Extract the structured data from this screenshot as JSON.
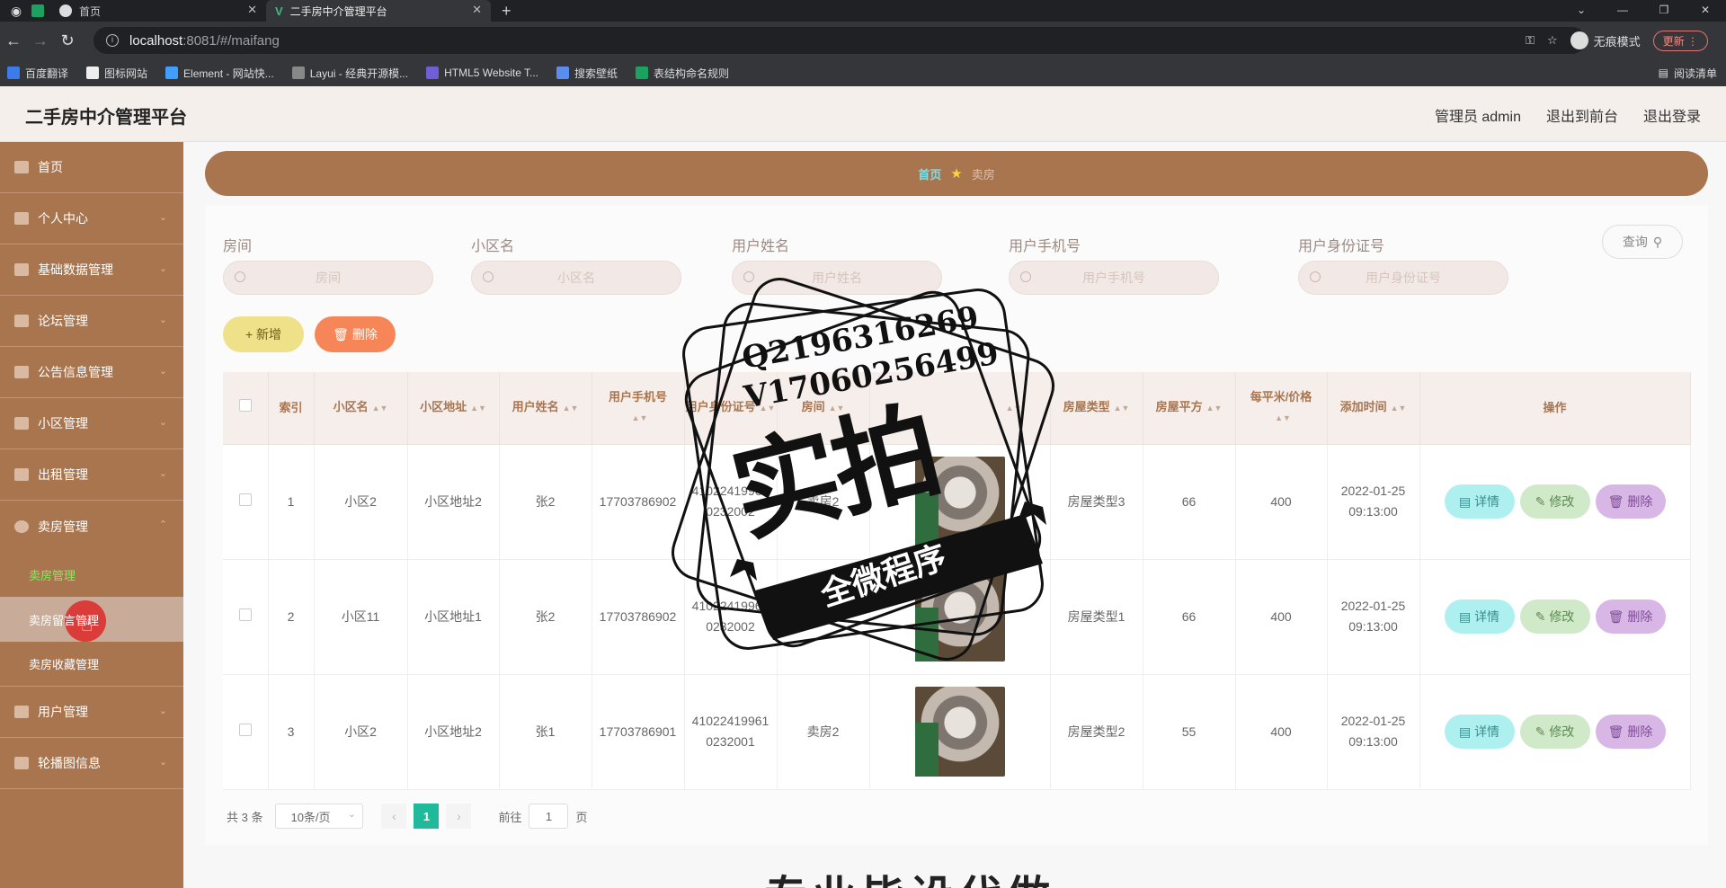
{
  "browser": {
    "tabs": [
      {
        "label": "首页",
        "active": false
      },
      {
        "label": "二手房中介管理平台",
        "active": true
      }
    ],
    "url_host": "localhost",
    "url_path": ":8081/#/maifang",
    "incognito_label": "无痕模式",
    "update_label": "更新",
    "reading_list": "阅读清单",
    "bookmarks": [
      "百度翻译",
      "图标网站",
      "Element - 网站快...",
      "Layui - 经典开源模...",
      "HTML5 Website T...",
      "搜索壁纸",
      "表结构命名规则"
    ]
  },
  "header": {
    "title": "二手房中介管理平台",
    "links": [
      "管理员 admin",
      "退出到前台",
      "退出登录"
    ]
  },
  "sidebar": {
    "items": [
      {
        "label": "首页"
      },
      {
        "label": "个人中心"
      },
      {
        "label": "基础数据管理"
      },
      {
        "label": "论坛管理"
      },
      {
        "label": "公告信息管理"
      },
      {
        "label": "小区管理"
      },
      {
        "label": "出租管理"
      },
      {
        "label": "卖房管理"
      }
    ],
    "sub_items": [
      "卖房管理",
      "卖房留言管理",
      "卖房收藏管理"
    ],
    "items_after": [
      {
        "label": "用户管理"
      },
      {
        "label": "轮播图信息"
      }
    ]
  },
  "breadcrumb": {
    "home": "首页",
    "current": "卖房"
  },
  "search": {
    "fields": [
      {
        "label": "房间",
        "placeholder": "房间"
      },
      {
        "label": "小区名",
        "placeholder": "小区名"
      },
      {
        "label": "用户姓名",
        "placeholder": "用户姓名"
      },
      {
        "label": "用户手机号",
        "placeholder": "用户手机号"
      },
      {
        "label": "用户身份证号",
        "placeholder": "用户身份证号"
      }
    ],
    "query_label": "查询"
  },
  "actions": {
    "add": "+ 新增",
    "delete": "删除"
  },
  "table": {
    "headers": [
      "索引",
      "小区名",
      "小区地址",
      "用户姓名",
      "用户手机号",
      "用户身份证号",
      "房间",
      "",
      "房屋类型",
      "房屋平方",
      "每平米/价格",
      "添加时间",
      "操作"
    ],
    "rows": [
      {
        "idx": "1",
        "community": "小区2",
        "address": "小区地址2",
        "user": "张2",
        "phone": "17703786902",
        "idcard": "410224199610232002",
        "room": "卖房2",
        "type": "房屋类型3",
        "area": "66",
        "price": "400",
        "date": "2022-01-25",
        "time": "09:13:00"
      },
      {
        "idx": "2",
        "community": "小区11",
        "address": "小区地址1",
        "user": "张2",
        "phone": "17703786902",
        "idcard": "410224199610232002",
        "room": "卖房1",
        "type": "房屋类型1",
        "area": "66",
        "price": "400",
        "date": "2022-01-25",
        "time": "09:13:00"
      },
      {
        "idx": "3",
        "community": "小区2",
        "address": "小区地址2",
        "user": "张1",
        "phone": "17703786901",
        "idcard": "410224199610232001",
        "room": "卖房2",
        "type": "房屋类型2",
        "area": "55",
        "price": "400",
        "date": "2022-01-25",
        "time": "09:13:00"
      }
    ],
    "op_labels": {
      "detail": "详情",
      "edit": "修改",
      "delete": "删除"
    }
  },
  "pagination": {
    "total": "共 3 条",
    "page_size": "10条/页",
    "current": "1",
    "goto_prefix": "前往",
    "goto_value": "1",
    "goto_suffix": "页"
  },
  "watermark": {
    "line1": "Q2196316269",
    "line2": "V17060256499",
    "big": "实拍",
    "ribbon": "全微程序"
  },
  "bottom_text": "专业毕设代做"
}
